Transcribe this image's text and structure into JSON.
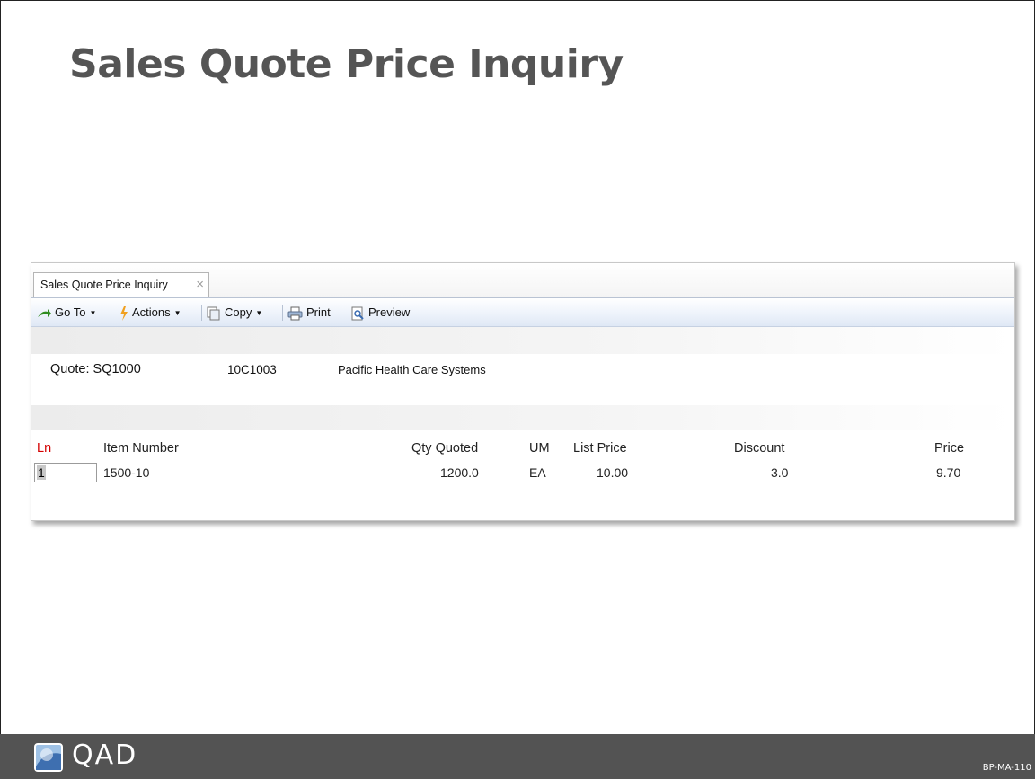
{
  "slide": {
    "title": "Sales Quote Price Inquiry",
    "footer_code": "BP-MA-110",
    "logo_text": "QAD"
  },
  "window": {
    "tab_label": "Sales Quote Price Inquiry",
    "tab_close": "×",
    "toolbar": {
      "goto_label": "Go To",
      "actions_label": "Actions",
      "copy_label": "Copy",
      "print_label": "Print",
      "preview_label": "Preview"
    },
    "quote_label": "Quote: SQ1000",
    "customer_code": "10C1003",
    "customer_name": "Pacific Health Care Systems",
    "columns": {
      "ln": "Ln",
      "item_number": "Item Number",
      "qty_quoted": "Qty Quoted",
      "um": "UM",
      "list_price": "List Price",
      "discount": "Discount",
      "price": "Price"
    },
    "rows": [
      {
        "ln": "1",
        "item_number": "1500-10",
        "qty_quoted": "1200.0",
        "um": "EA",
        "list_price": "10.00",
        "discount": "3.0",
        "price": "9.70"
      }
    ],
    "colors": {
      "ln_header": "#d40000",
      "accent_green": "#2e8b1e",
      "icon_orange": "#f0a020"
    }
  }
}
